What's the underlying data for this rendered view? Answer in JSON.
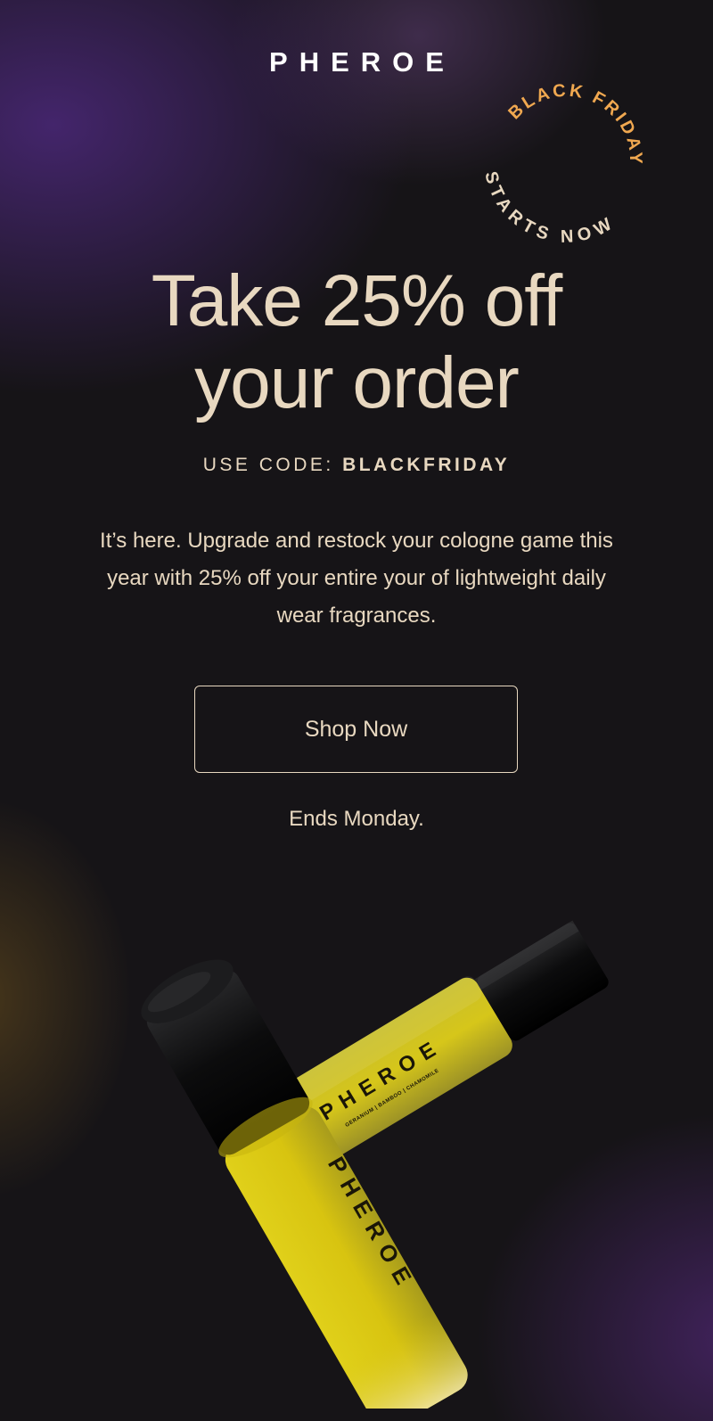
{
  "brand": {
    "logo": "PHEROE"
  },
  "badge": {
    "line1": "BLACK FRIDAY",
    "line2": "STARTS NOW"
  },
  "hero": {
    "headline_line1": "Take 25% off",
    "headline_line2": "your order",
    "code_label": "USE CODE: ",
    "code_value": "BLACKFRIDAY",
    "body": "It’s here. Upgrade and restock your cologne game this year with 25% off your entire your of lightweight daily wear fragrances.",
    "cta_label": "Shop Now",
    "ends_text": "Ends Monday."
  },
  "product": {
    "front_label": "PHEROE",
    "back_label": "PHEROE",
    "back_notes": "GERANIUM | BAMBOO | CHAMOMILE"
  },
  "colors": {
    "accent_gold": "#e8d8c0",
    "badge_orange": "#f0a850",
    "bottle_yellow": "#d8c410",
    "background": "#161417"
  }
}
